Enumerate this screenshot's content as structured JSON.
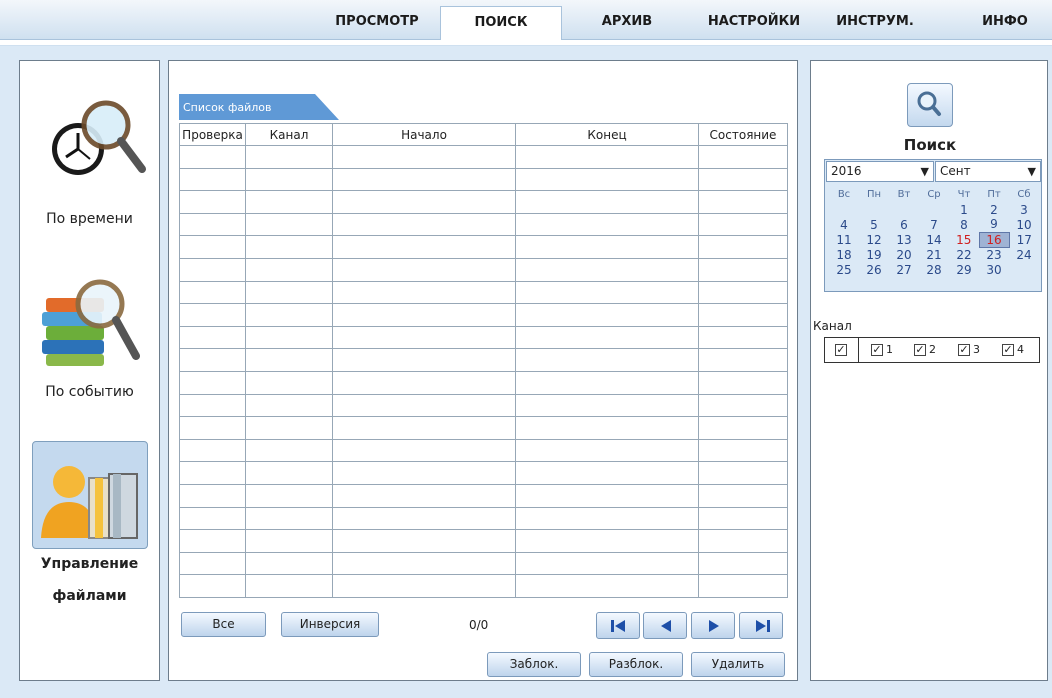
{
  "nav": {
    "tabs": [
      "ПРОСМОТР",
      "ПОИСК",
      "АРХИВ",
      "НАСТРОЙКИ",
      "ИНСТРУМ.",
      "ИНФО"
    ],
    "active": "ПОИСК"
  },
  "modes": {
    "by_time": "По времени",
    "by_event": "По событию",
    "manage_1": "Управление",
    "manage_2": "файлами"
  },
  "file_list": {
    "tab_label": "Список файлов",
    "columns": [
      "Проверка",
      "Канал",
      "Начало",
      "Конец",
      "Состояние"
    ],
    "counter": "0/0"
  },
  "buttons": {
    "all": "Все",
    "invert": "Инверсия",
    "lock": "Заблок.",
    "unlock": "Разблок.",
    "delete": "Удалить"
  },
  "search": {
    "title": "Поиск",
    "year": "2016",
    "month": "Сент",
    "weekdays": [
      "Вс",
      "Пн",
      "Вт",
      "Ср",
      "Чт",
      "Пт",
      "Сб"
    ],
    "days": [
      [
        "",
        "",
        "",
        "",
        "1",
        "2",
        "3"
      ],
      [
        "4",
        "5",
        "6",
        "7",
        "8",
        "9",
        "10"
      ],
      [
        "11",
        "12",
        "13",
        "14",
        "15",
        "16",
        "17"
      ],
      [
        "18",
        "19",
        "20",
        "21",
        "22",
        "23",
        "24"
      ],
      [
        "25",
        "26",
        "27",
        "28",
        "29",
        "30",
        ""
      ]
    ],
    "highlight_red": "15",
    "selected": "16",
    "channel_label": "Канал",
    "channels": [
      "1",
      "2",
      "3",
      "4"
    ]
  }
}
